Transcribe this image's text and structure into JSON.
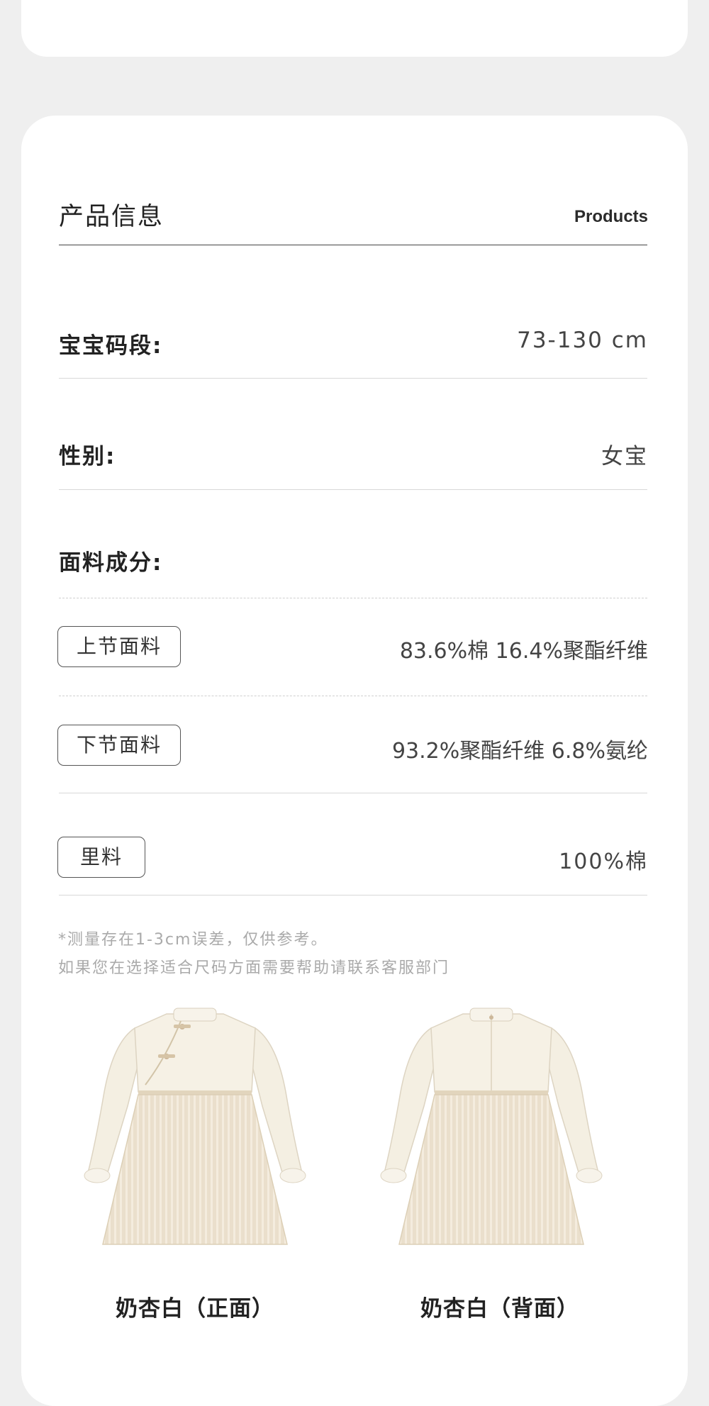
{
  "header": {
    "title": "产品信息",
    "subtitle": "Products"
  },
  "specs": {
    "size": {
      "label": "宝宝码段:",
      "value": "73-130 cm"
    },
    "gender": {
      "label": "性别:",
      "value": "女宝"
    },
    "fabric_heading": "面料成分:",
    "upper": {
      "tag": "上节面料",
      "value": "83.6%棉 16.4%聚酯纤维"
    },
    "lower": {
      "tag": "下节面料",
      "value": "93.2%聚酯纤维 6.8%氨纶"
    },
    "lining": {
      "tag": "里料",
      "value": "100%棉"
    }
  },
  "notes": {
    "line1": "*测量存在1-3cm误差，仅供参考。",
    "line2": "如果您在选择适合尺码方面需要帮助请联系客服部门"
  },
  "products": [
    {
      "caption": "奶杏白（正面）",
      "icon": "dress-front-illustration"
    },
    {
      "caption": "奶杏白（背面）",
      "icon": "dress-back-illustration"
    }
  ],
  "colors": {
    "page_bg": "#efefef",
    "card_bg": "#ffffff",
    "dress_top": "#f5f0e4",
    "dress_skirt": "#e8dcc8"
  }
}
